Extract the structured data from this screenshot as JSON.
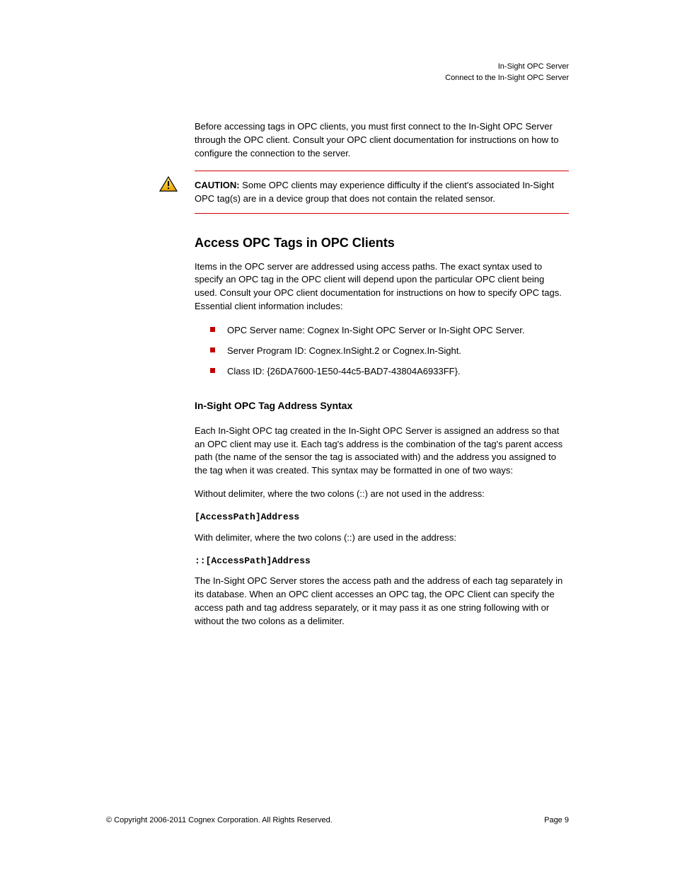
{
  "header": {
    "product": "In-Sight OPC Server",
    "section_title": "Connect to the In-Sight OPC Server"
  },
  "body": {
    "intro": "Before accessing tags in OPC clients, you must first connect to the In-Sight OPC Server through the OPC client. Consult your OPC client documentation for instructions on how to configure the connection to the server.",
    "caution_label": "CAUTION:",
    "caution_text": "Some OPC clients may experience difficulty if the client's associated In-Sight OPC tag(s) are in a device group that does not contain the related sensor.",
    "section_heading": "Access OPC Tags in OPC Clients",
    "section_body": "Items in the OPC server are addressed using access paths. The exact syntax used to specify an OPC tag in the OPC client will depend upon the particular OPC client being used. Consult your OPC client documentation for instructions on how to specify OPC tags. Essential client information includes:",
    "bullets": [
      "OPC Server name: Cognex In-Sight OPC Server or In-Sight OPC Server.",
      "Server Program ID: Cognex.InSight.2 or Cognex.In-Sight.",
      "Class ID: {26DA7600-1E50-44c5-BAD7-43804A6933FF}."
    ],
    "sub_heading": "In-Sight OPC Tag Address Syntax",
    "sub_body_1": "Each In-Sight OPC tag created in the In-Sight OPC Server is assigned an address so that an OPC client may use it. Each tag's address is the combination of the tag's parent access path (the name of the sensor the tag is associated with) and the address you assigned to the tag when it was created. This syntax may be formatted in one of two ways:",
    "without_delim_label": "Without delimiter, where the two colons (::) are not used in the address:",
    "without_delim_code": "[AccessPath]Address",
    "with_delim_label": "With delimiter, where the two colons (::) are used in the address:",
    "with_delim_code": "::[AccessPath]Address",
    "sub_body_2": "The In-Sight OPC Server stores the access path and the address of each tag separately in its database. When an OPC client accesses an OPC tag, the OPC Client can specify the access path and tag address separately, or it may pass it as one string following with or without the two colons as a delimiter."
  },
  "footer": {
    "copyright": "© Copyright 2006-2011 Cognex Corporation. All Rights Reserved.",
    "page_label": "Page",
    "page_num": "9"
  }
}
